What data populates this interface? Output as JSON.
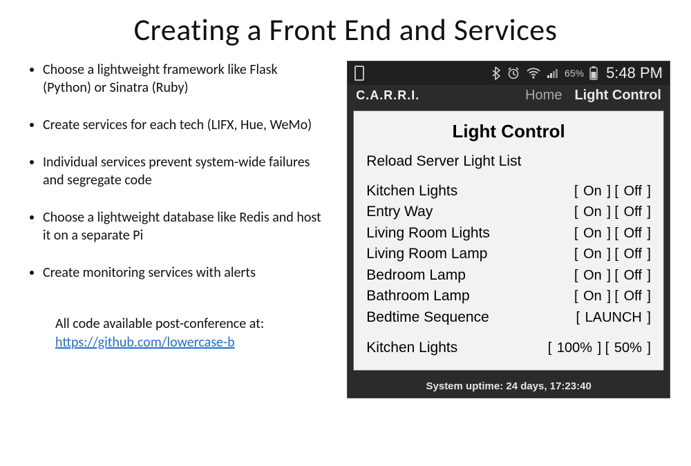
{
  "title": "Creating a Front End and Services",
  "bullets": [
    "Choose a lightweight framework like Flask (Python) or Sinatra (Ruby)",
    "Create services for each tech (LIFX, Hue, WeMo)",
    "Individual services prevent system-wide failures and segregate code",
    "Choose a lightweight database like Redis and host it on a separate Pi",
    "Create monitoring services with alerts"
  ],
  "footnote": {
    "lead": "All code available post-conference at:",
    "url_text": "https://github.com/lowercase-b"
  },
  "phone": {
    "status": {
      "battery_pct": "65%",
      "clock": "5:48 PM"
    },
    "appbar": {
      "app_name": "C.A.R.R.I.",
      "tabs": {
        "home": "Home",
        "light": "Light Control"
      }
    },
    "panel": {
      "title": "Light Control",
      "reload_label": "Reload Server Light List",
      "on_label": "On",
      "off_label": "Off",
      "launch_label": "LAUNCH",
      "lights": [
        {
          "name": "Kitchen Lights",
          "type": "onoff"
        },
        {
          "name": "Entry Way",
          "type": "onoff"
        },
        {
          "name": "Living Room Lights",
          "type": "onoff"
        },
        {
          "name": "Living Room Lamp",
          "type": "onoff"
        },
        {
          "name": "Bedroom Lamp",
          "type": "onoff"
        },
        {
          "name": "Bathroom Lamp",
          "type": "onoff"
        },
        {
          "name": "Bedtime Sequence",
          "type": "launch"
        }
      ],
      "extra": {
        "name": "Kitchen Lights",
        "levels": [
          "100%",
          "50%"
        ]
      }
    },
    "uptime": "System uptime: 24 days, 17:23:40"
  }
}
